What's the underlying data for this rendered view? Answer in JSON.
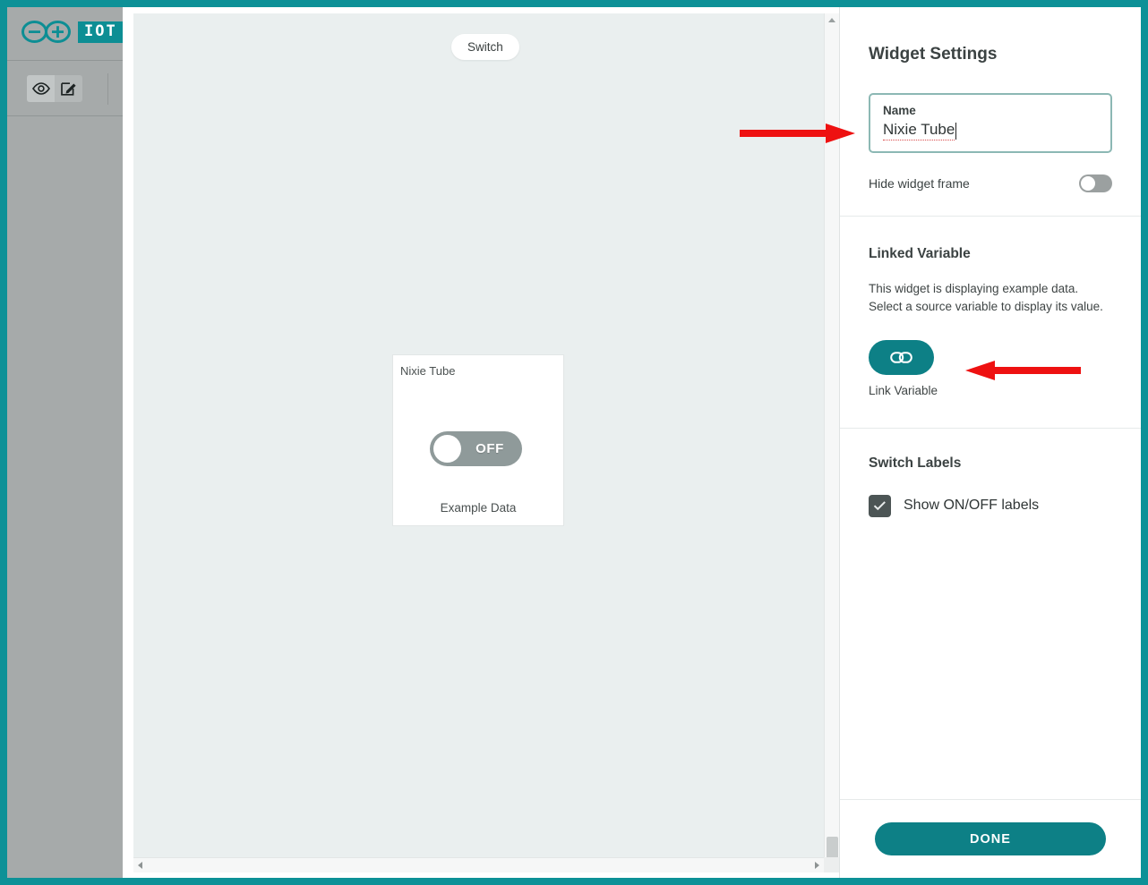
{
  "window": {
    "frame_color": "#0d9197"
  },
  "sidebar": {
    "logo": {
      "name": "arduino-infinity-logo",
      "badge_text": "IOT"
    },
    "mode_buttons": [
      {
        "name": "preview-mode",
        "icon": "eye-icon",
        "active": true
      },
      {
        "name": "edit-mode",
        "icon": "pencil-edit-icon",
        "active": false
      }
    ]
  },
  "canvas": {
    "pill_label": "Switch",
    "widget": {
      "title": "Nixie Tube",
      "toggle_state_label": "OFF",
      "footer": "Example Data"
    },
    "scrollbar": {
      "up_arrow": "scroll-up-icon",
      "down_arrow": "scroll-down-icon",
      "left_arrow": "scroll-left-icon",
      "right_arrow": "scroll-right-icon"
    }
  },
  "panel": {
    "title": "Widget Settings",
    "name_field": {
      "label": "Name",
      "value": "Nixie Tube"
    },
    "hide_widget_frame": {
      "label": "Hide widget frame",
      "state": "off"
    },
    "linked_variable": {
      "heading": "Linked Variable",
      "description": "This widget is displaying example data. Select a source variable to display its value.",
      "button_icon": "chain-link-icon",
      "button_label": "Link Variable",
      "accent_color": "#0d8086"
    },
    "switch_labels": {
      "heading": "Switch Labels",
      "checkbox_label": "Show ON/OFF labels",
      "checked": true
    },
    "footer": {
      "done_label": "DONE",
      "done_color": "#0d8086"
    }
  },
  "annotations": {
    "color": "#ee1111",
    "arrows": [
      {
        "name": "arrow-pointing-to-name-field",
        "direction": "right"
      },
      {
        "name": "arrow-pointing-to-link-variable-button",
        "direction": "left"
      }
    ]
  }
}
